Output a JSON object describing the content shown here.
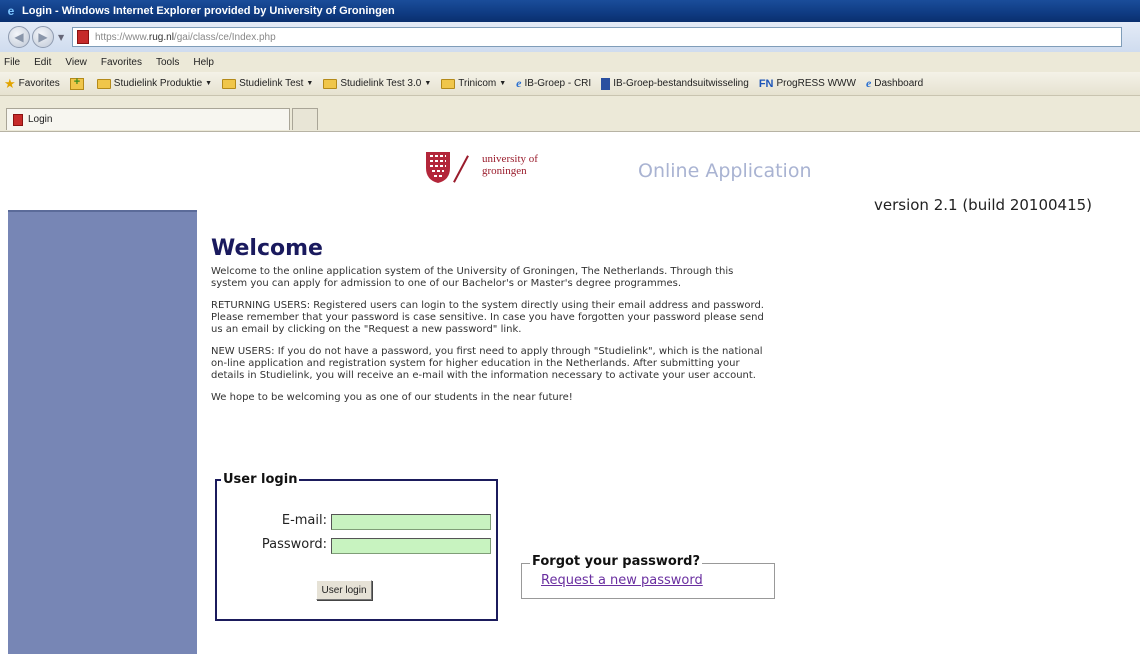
{
  "browser": {
    "window_title": "Login - Windows Internet Explorer provided by University of Groningen",
    "address": {
      "scheme": "https://www.",
      "host": "rug.nl",
      "path": "/gai/class/ce/Index.php"
    },
    "menu": [
      "File",
      "Edit",
      "View",
      "Favorites",
      "Tools",
      "Help"
    ],
    "favorites_label": "Favorites",
    "favorites_bar": [
      {
        "label": "Studielink Produktie",
        "icon": "folder-icon",
        "dropdown": true
      },
      {
        "label": "Studielink Test",
        "icon": "folder-icon",
        "dropdown": true
      },
      {
        "label": "Studielink Test 3.0",
        "icon": "folder-icon",
        "dropdown": true
      },
      {
        "label": "Trinicom",
        "icon": "folder-icon",
        "dropdown": true
      },
      {
        "label": "IB-Groep - CRI",
        "icon": "ie-page-icon",
        "dropdown": false
      },
      {
        "label": "IB-Groep-bestandsuitwisseling",
        "icon": "document-icon",
        "dropdown": false
      },
      {
        "label": "ProgRESS WWW",
        "icon": "fn-icon",
        "dropdown": false
      },
      {
        "label": "Dashboard",
        "icon": "ie-page-icon",
        "dropdown": false
      }
    ],
    "tab_label": "Login"
  },
  "page": {
    "logo_text": [
      "university of",
      "groningen"
    ],
    "header_title": "Online Application",
    "version": "version 2.1 (build 20100415)",
    "welcome_title": "Welcome",
    "paragraphs": [
      "Welcome to the online application system of the University of Groningen, The Netherlands. Through this system you can apply for admission to one of our Bachelor's or Master's degree programmes.",
      "RETURNING USERS: Registered users can login to the system directly using their email address and password. Please remember that your password is case sensitive. In case you have forgotten your password please send us an email by clicking on the \"Request a new password\" link.",
      "NEW USERS: If you do not have a password, you first need to apply through \"Studielink\", which is the national on-line application and registration system for higher education in the Netherlands. After submitting your details in Studielink, you will receive an e-mail with the information necessary to activate your user account.",
      "We hope to be welcoming you as one of our students in the near future!"
    ],
    "login": {
      "legend": "User login",
      "email_label": "E-mail:",
      "email_value": "",
      "password_label": "Password:",
      "password_value": "",
      "button": "User login"
    },
    "forgot": {
      "legend": "Forgot your password?",
      "link": "Request a new password"
    }
  },
  "colors": {
    "sidebar": "#7786b5",
    "title_blue": "#1a1a5e",
    "brand_red": "#9a1c2c",
    "input_green": "#c8f3c0",
    "link_purple": "#6a2fa0"
  }
}
